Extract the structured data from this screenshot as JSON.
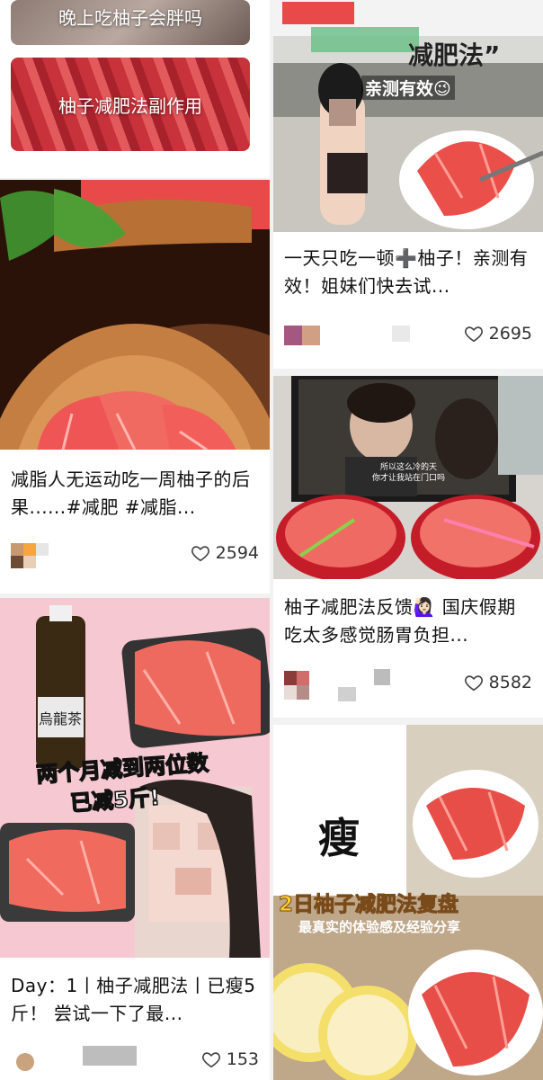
{
  "cards": [
    {
      "id": "tile1",
      "label": "晚上吃柚子会胖吗"
    },
    {
      "id": "tile2",
      "label": "柚子减肥法副作用"
    },
    {
      "id": "card3",
      "title": "减脂人无运动吃一周柚子的后果......#减肥 #减脂...",
      "likes": "2594"
    },
    {
      "id": "card4",
      "title": "Day：1丨柚子减肥法丨已瘦5斤！ 尝试一下了最...",
      "likes": "153",
      "overlay_line1": "两个月减到两位数",
      "overlay_line2": "已减5斤!",
      "bottle_label": "烏龍茶"
    },
    {
      "id": "card5",
      "title": "一天只吃一顿➕柚子！亲测有效！姐妹们快去试...",
      "likes": "2695",
      "overlay_top": "减肥法”",
      "overlay_sub": "亲测有效😉"
    },
    {
      "id": "card6",
      "title": "柚子减肥法反馈🙋🏻‍♀️ 国庆假期吃太多感觉肠胃负担...",
      "likes": "8582",
      "subtitle_line1": "所以这么冷的天",
      "subtitle_line2": "你才让我站在门口吗"
    },
    {
      "id": "card7",
      "overlay_char": "瘦",
      "overlay_title": "2日柚子减肥法复盘",
      "overlay_sub": "最真实的体验感及经验分享"
    }
  ],
  "colors": {
    "accent": "#e84a4a",
    "pomelo": "#ef5a55",
    "wood": "#c8884a",
    "bg": "#f2f2f2"
  },
  "icons": {
    "like": "heart-outline-icon"
  }
}
